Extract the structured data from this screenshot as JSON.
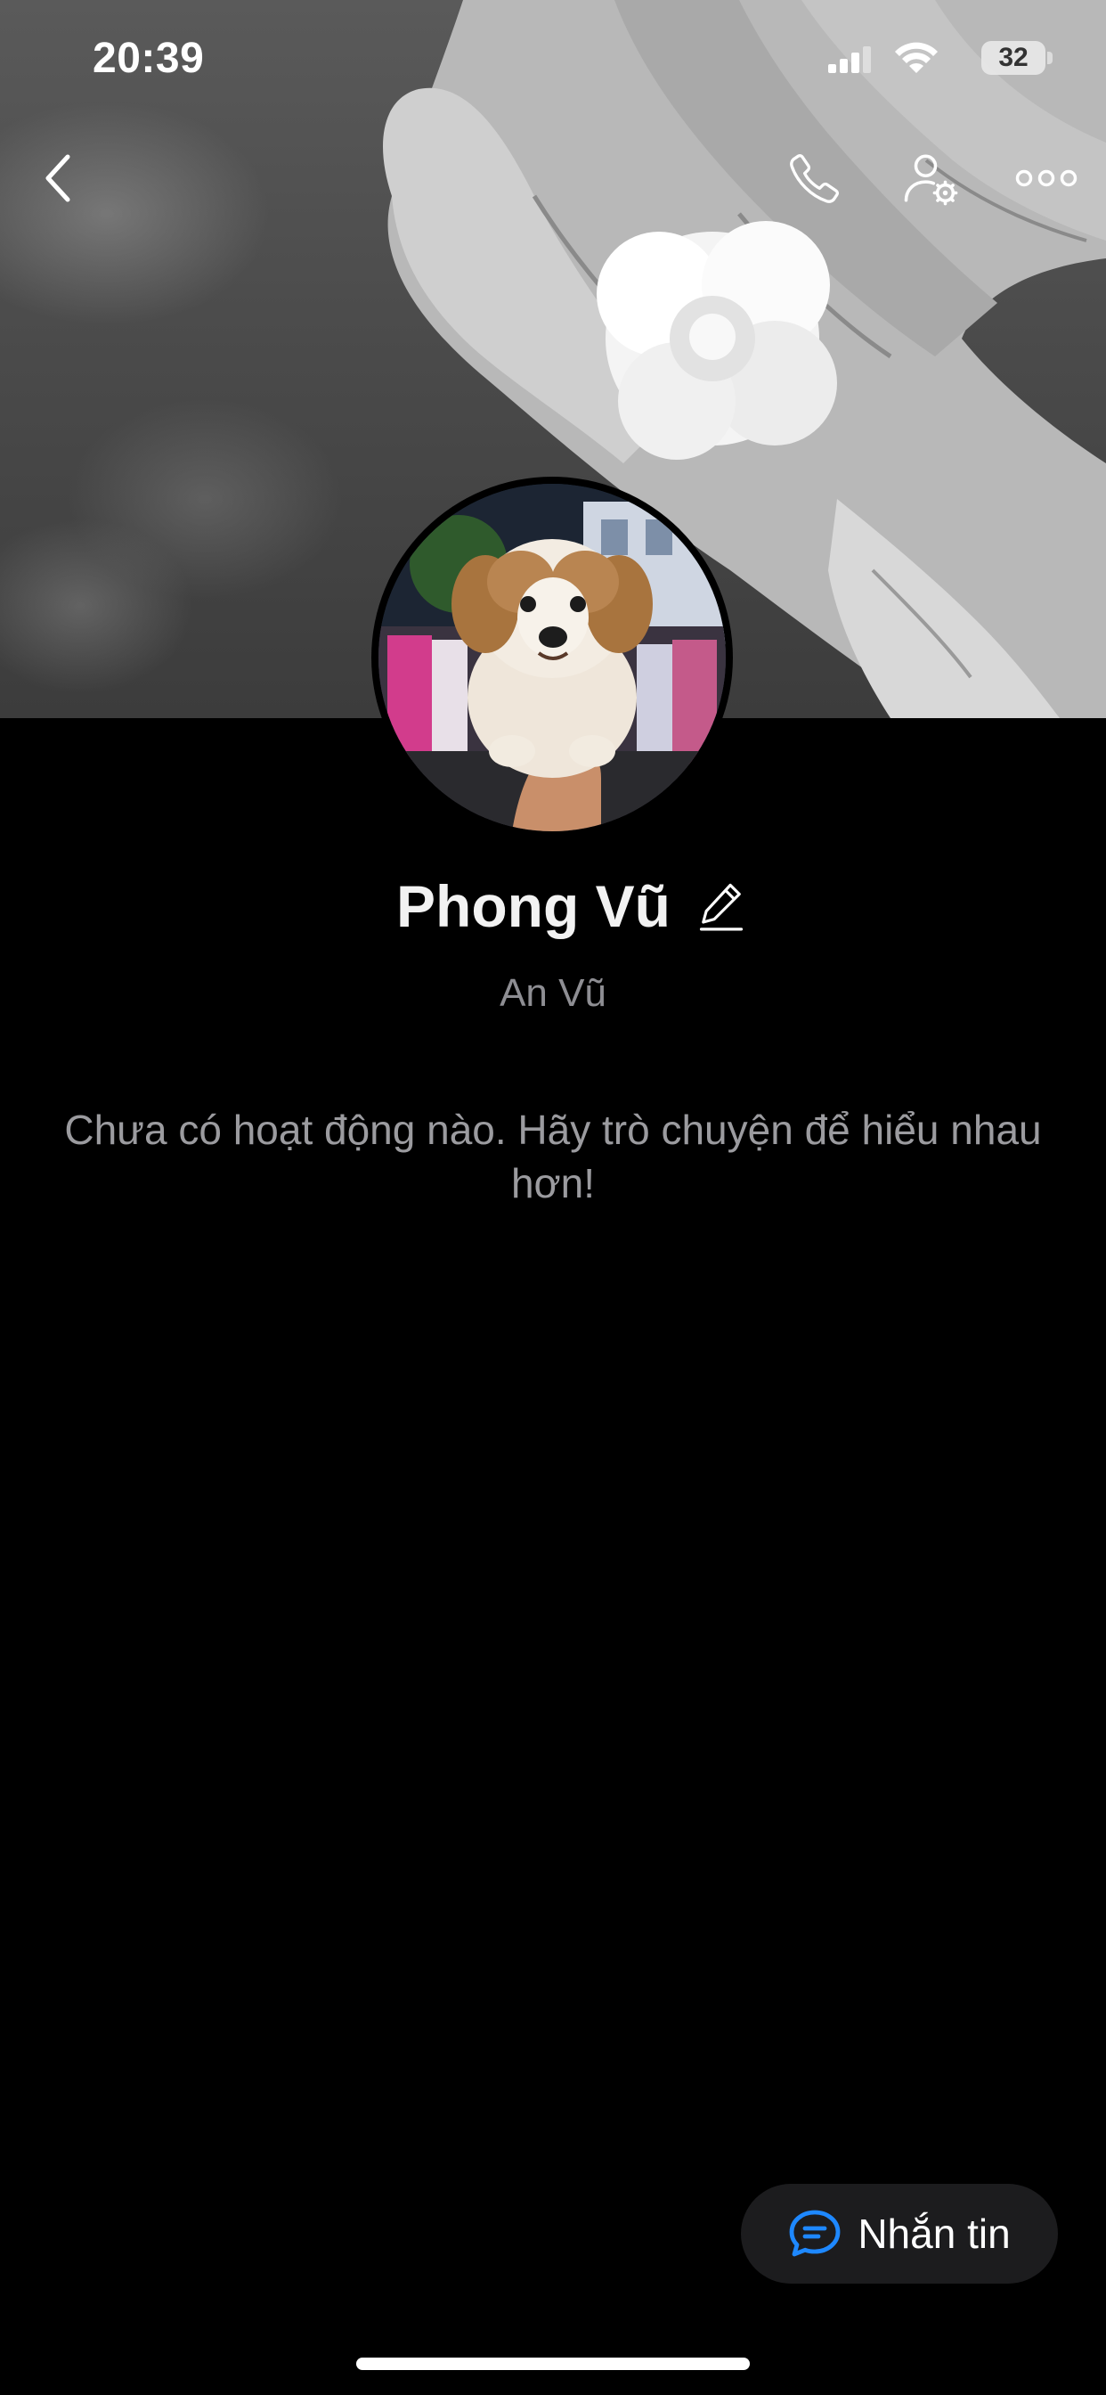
{
  "status_bar": {
    "time": "20:39",
    "battery_level": "32"
  },
  "header": {
    "back_icon": "chevron-left-icon",
    "call_icon": "phone-icon",
    "settings_icon": "user-gear-icon",
    "more_icon": "ellipsis-icon"
  },
  "profile": {
    "name": "Phong Vũ",
    "nickname": "An Vũ",
    "edit_icon": "pencil-icon"
  },
  "activity": {
    "empty_message": "Chưa có hoạt động nào. Hãy trò chuyện để hiểu nhau hơn!"
  },
  "actions": {
    "message_label": "Nhắn tin",
    "message_icon": "chat-bubble-icon"
  },
  "colors": {
    "background": "#000000",
    "accent_blue": "#1e88ff",
    "secondary_text": "#8e8e93"
  }
}
